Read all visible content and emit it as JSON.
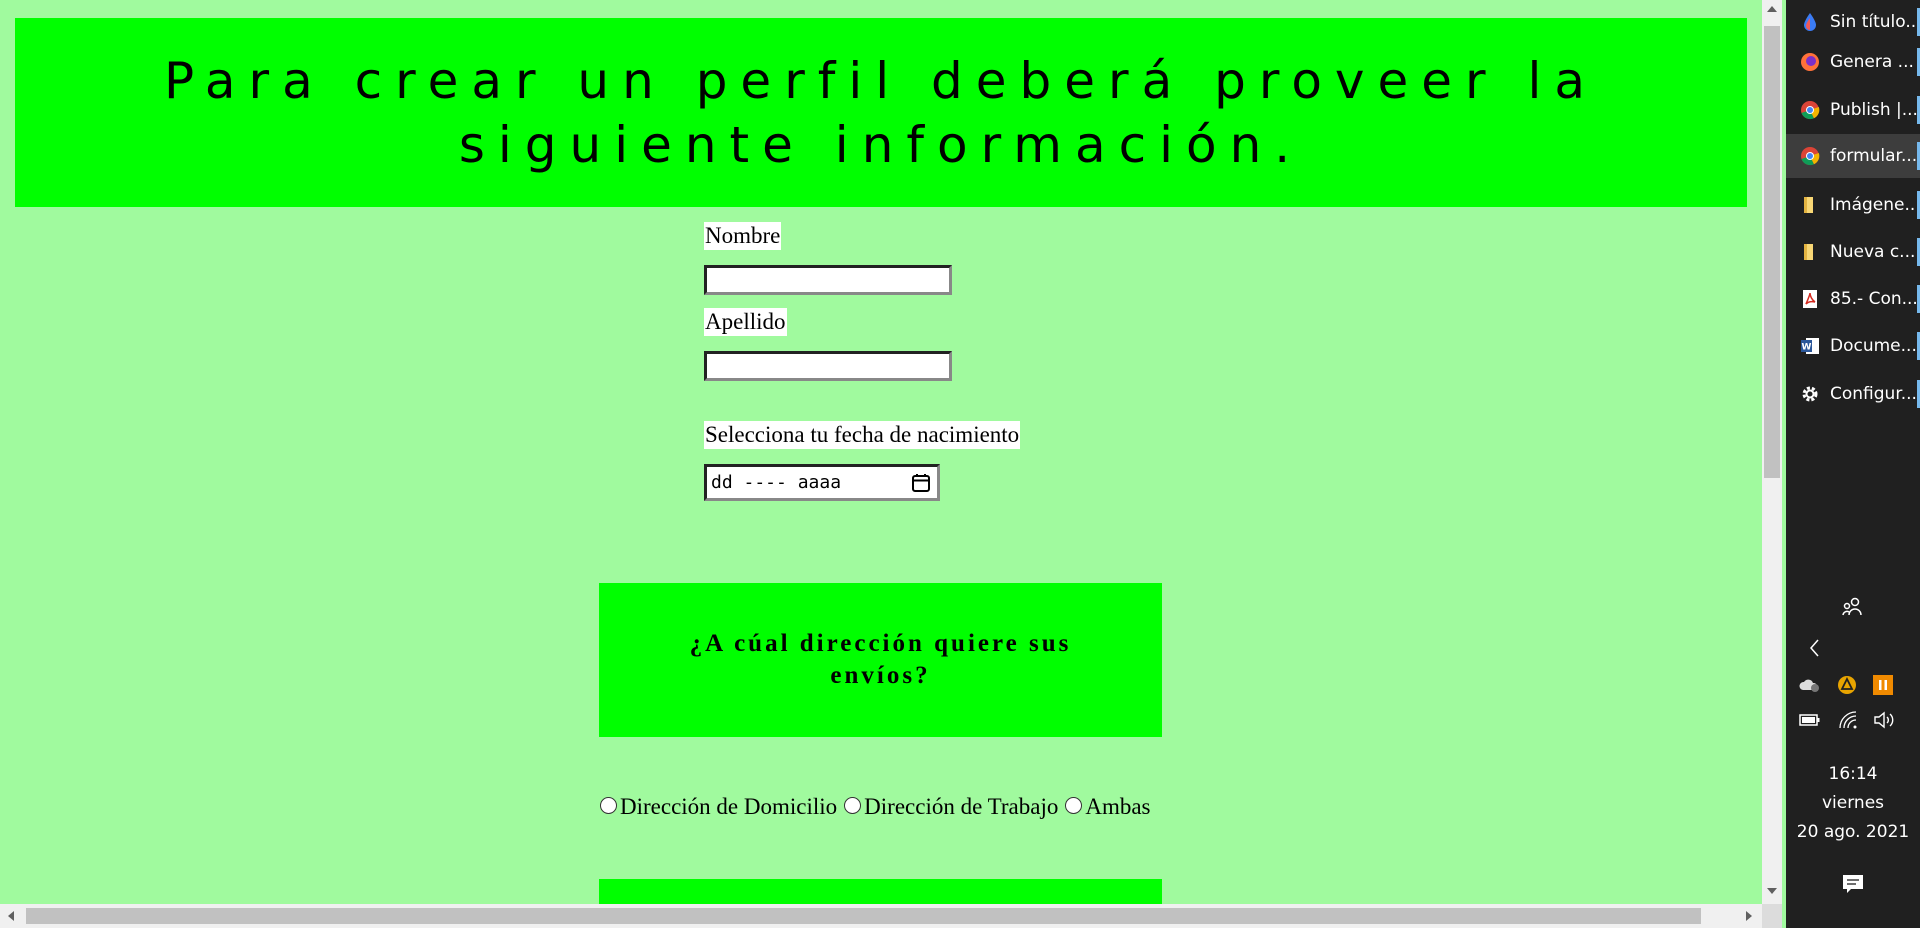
{
  "header": {
    "title": "Para crear un perfil deberá proveer la siguiente información."
  },
  "form": {
    "nombre_label": "Nombre",
    "nombre_value": "",
    "apellido_label": "Apellido",
    "apellido_value": "",
    "fecha_label": "Selecciona tu fecha de nacimiento",
    "fecha_placeholder": "dd ---- aaaa"
  },
  "shipping": {
    "title": "¿A cúal dirección quiere sus envíos?",
    "options": [
      "Dirección de Domicilio",
      "Dirección de Trabajo",
      "Ambas"
    ]
  },
  "taskbar": {
    "items": [
      {
        "label": "Sin título...",
        "icon": "drop-icon"
      },
      {
        "label": "Genera ...",
        "icon": "firefox-icon"
      },
      {
        "label": "Publish |...",
        "icon": "chrome-icon"
      },
      {
        "label": "formular...",
        "icon": "chrome-icon"
      },
      {
        "label": "Imágene...",
        "icon": "folder-icon"
      },
      {
        "label": "Nueva c...",
        "icon": "folder-icon"
      },
      {
        "label": "85.- Con...",
        "icon": "pdf-icon"
      },
      {
        "label": "Docume...",
        "icon": "word-icon"
      },
      {
        "label": "Configur...",
        "icon": "gear-icon"
      }
    ],
    "active_index": 3,
    "clock": {
      "time": "16:14",
      "day": "viernes",
      "date": "20 ago. 2021"
    }
  },
  "colors": {
    "page_bg": "#a0fa9e",
    "accent_green": "#00ff00",
    "taskbar_bg": "#202020"
  }
}
